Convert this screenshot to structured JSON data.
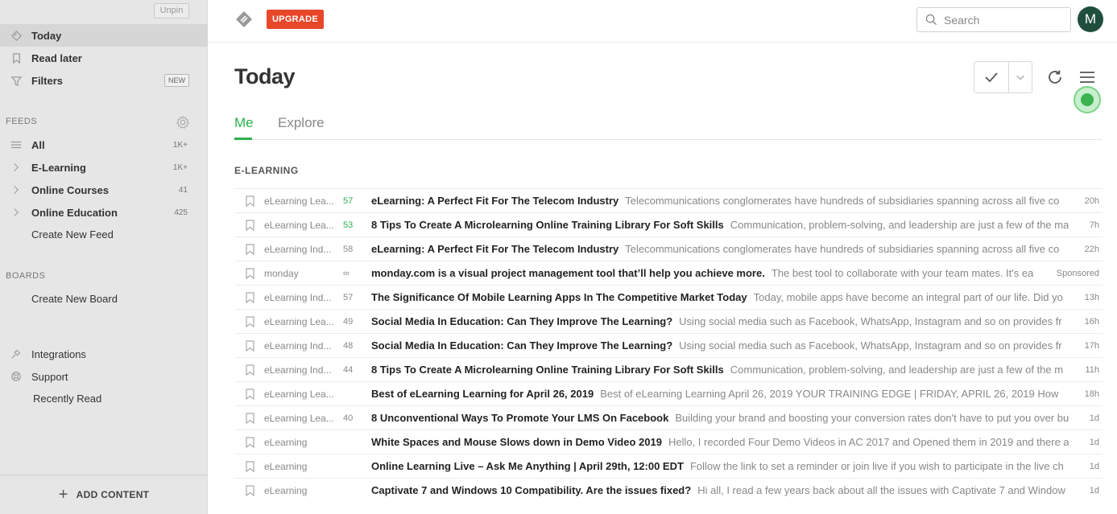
{
  "sidebar": {
    "unpin_label": "Unpin",
    "nav": [
      {
        "label": "Today",
        "icon": "today-icon"
      },
      {
        "label": "Read later",
        "icon": "bookmark-icon"
      },
      {
        "label": "Filters",
        "icon": "filter-icon",
        "badge": "NEW"
      }
    ],
    "feeds_label": "FEEDS",
    "feeds": [
      {
        "label": "All",
        "count": "1K+"
      },
      {
        "label": "E-Learning",
        "count": "1K+"
      },
      {
        "label": "Online Courses",
        "count": "41"
      },
      {
        "label": "Online Education",
        "count": "425"
      }
    ],
    "create_feed": "Create New Feed",
    "boards_label": "BOARDS",
    "create_board": "Create New Board",
    "utilities": [
      {
        "label": "Integrations",
        "icon": "integrations-icon"
      },
      {
        "label": "Support",
        "icon": "support-icon"
      }
    ],
    "recently_read": "Recently Read",
    "add_content": "ADD CONTENT"
  },
  "topbar": {
    "upgrade_label": "UPGRADE",
    "search_placeholder": "Search",
    "avatar_initial": "M"
  },
  "main": {
    "title": "Today",
    "tabs": [
      {
        "label": "Me",
        "active": true
      },
      {
        "label": "Explore",
        "active": false
      }
    ],
    "category": "E-LEARNING",
    "articles": [
      {
        "source": "eLearning Lea...",
        "pop": "57",
        "hot": true,
        "title": "eLearning: A Perfect Fit For The Telecom Industry",
        "summary": "Telecommunications conglomerates have hundreds of subsidiaries spanning across all five co",
        "age": "20h"
      },
      {
        "source": "eLearning Lea...",
        "pop": "53",
        "hot": true,
        "title": "8 Tips To Create A Microlearning Online Training Library For Soft Skills",
        "summary": "Communication, problem-solving, and leadership are just a few of the ma",
        "age": "7h"
      },
      {
        "source": "eLearning Ind...",
        "pop": "58",
        "hot": false,
        "title": "eLearning: A Perfect Fit For The Telecom Industry",
        "summary": "Telecommunications conglomerates have hundreds of subsidiaries spanning across all five co",
        "age": "22h"
      },
      {
        "source": "monday",
        "pop": "∞",
        "hot": false,
        "title": "monday.com is a visual project management tool that’ll help you achieve more.",
        "summary": "The best tool to collaborate with your team mates. It's ea",
        "age": "Sponsored"
      },
      {
        "source": "eLearning Ind...",
        "pop": "57",
        "hot": false,
        "title": "The Significance Of Mobile Learning Apps In The Competitive Market Today",
        "summary": "Today, mobile apps have become an integral part of our life. Did yo",
        "age": "13h"
      },
      {
        "source": "eLearning Lea...",
        "pop": "49",
        "hot": false,
        "title": "Social Media In Education: Can They Improve The Learning?",
        "summary": "Using social media such as Facebook, WhatsApp, Instagram and so on provides fr",
        "age": "16h"
      },
      {
        "source": "eLearning Ind...",
        "pop": "48",
        "hot": false,
        "title": "Social Media In Education: Can They Improve The Learning?",
        "summary": "Using social media such as Facebook, WhatsApp, Instagram and so on provides fr",
        "age": "17h"
      },
      {
        "source": "eLearning Ind...",
        "pop": "44",
        "hot": false,
        "title": "8 Tips To Create A Microlearning Online Training Library For Soft Skills",
        "summary": "Communication, problem-solving, and leadership are just a few of the m",
        "age": "11h"
      },
      {
        "source": "eLearning Lea...",
        "pop": "",
        "hot": false,
        "title": "Best of eLearning Learning for April 26, 2019",
        "summary": "Best of eLearning Learning April 26, 2019 YOUR TRAINING EDGE | FRIDAY, APRIL 26, 2019 How",
        "age": "18h"
      },
      {
        "source": "eLearning Lea...",
        "pop": "40",
        "hot": false,
        "title": "8 Unconventional Ways To Promote Your LMS On Facebook",
        "summary": "Building your brand and boosting your conversion rates don't have to put you over bu",
        "age": "1d"
      },
      {
        "source": "eLearning",
        "pop": "",
        "hot": false,
        "title": "White Spaces and Mouse Slows down in Demo Video 2019",
        "summary": "Hello, I recorded Four Demo Videos in AC 2017 and Opened them in 2019 and there a",
        "age": "1d"
      },
      {
        "source": "eLearning",
        "pop": "",
        "hot": false,
        "title": "Online Learning Live – Ask Me Anything | April 29th, 12:00 EDT",
        "summary": "Follow the link to set a reminder or join live if you wish to participate in the live ch",
        "age": "1d"
      },
      {
        "source": "eLearning",
        "pop": "",
        "hot": false,
        "title": "Captivate 7 and Windows 10 Compatibility. Are the issues fixed?",
        "summary": "Hi all, I read a few years back about all the issues with Captivate 7 and Window",
        "age": "1d"
      }
    ]
  },
  "colors": {
    "accent_green": "#2bb24c",
    "upgrade_red": "#e8472a",
    "avatar_bg": "#1f4e3d"
  }
}
